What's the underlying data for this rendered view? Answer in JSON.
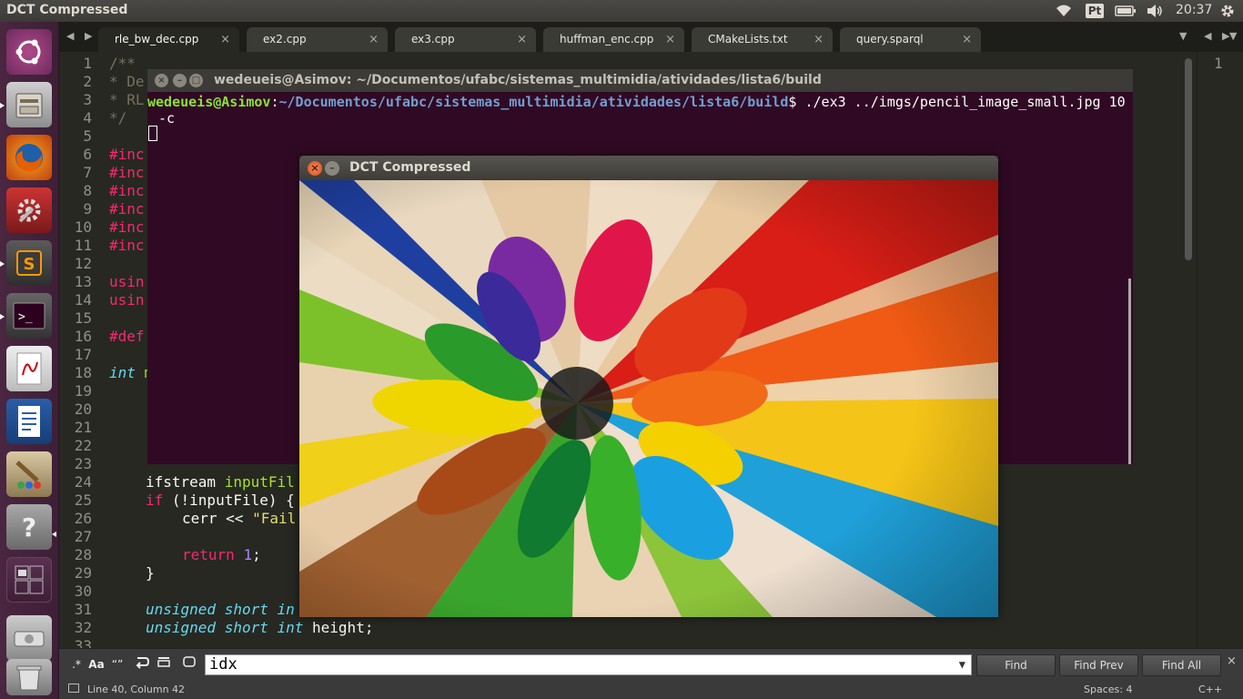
{
  "panel": {
    "title": "DCT Compressed",
    "keyboard": "Pt",
    "clock": "20:37"
  },
  "launcher": {
    "items": [
      "ubuntu-dash",
      "files",
      "firefox",
      "system-settings",
      "sublime-text",
      "terminal",
      "document-viewer",
      "libreoffice-writer",
      "gimp",
      "help",
      "workspace-switcher",
      "disk",
      "trash"
    ]
  },
  "tabs": [
    {
      "label": "rle_bw_dec.cpp",
      "active": true
    },
    {
      "label": "ex2.cpp",
      "active": false
    },
    {
      "label": "ex3.cpp",
      "active": false
    },
    {
      "label": "huffman_enc.cpp",
      "active": false
    },
    {
      "label": "CMakeLists.txt",
      "active": false
    },
    {
      "label": "query.sparql",
      "active": false
    }
  ],
  "editor": {
    "line_numbers": [
      "1",
      "2",
      "3",
      "4",
      "5",
      "6",
      "7",
      "8",
      "9",
      "10",
      "11",
      "12",
      "13",
      "14",
      "15",
      "16",
      "17",
      "18",
      "19",
      "20",
      "21",
      "22",
      "23",
      "24",
      "25",
      "26",
      "27",
      "28",
      "29",
      "30",
      "31",
      "32",
      "33"
    ],
    "right_line_number": "1",
    "lines": {
      "l1": "/**",
      "l2": "* De",
      "l3": "* RL",
      "l4": "*/",
      "l6": "#inc",
      "l7": "#inc",
      "l8": "#inc",
      "l9": "#inc",
      "l10": "#inc",
      "l11": "#inc",
      "l13": "usin",
      "l14": "usin",
      "l16": "#def",
      "l18_kw": "int",
      "l18_rest": "m",
      "l24_a": "ifstream ",
      "l24_b": "inputFil",
      "l25_kw": "if",
      "l25_rest": " (!inputFile) {",
      "l26_a": "cerr << ",
      "l26_b": "\"Fail",
      "l28_kw": "return",
      "l28_num": "1",
      "l28_end": ";",
      "l29": "}",
      "l31": "unsigned short in",
      "l32_ty": "unsigned short int",
      "l32_rest": " height;"
    }
  },
  "terminal": {
    "title": "wedeueis@Asimov: ~/Documentos/ufabc/sistemas_multimidia/atividades/lista6/build",
    "prompt_user": "wedeueis@Asimov",
    "prompt_sep": ":",
    "prompt_path": "~/Documentos/ufabc/sistemas_multimidia/atividades/lista6/build",
    "prompt_dollar": "$",
    "command": " ./ex3 ../imgs/pencil_image_small.jpg 10",
    "command_wrap": "-c"
  },
  "dct_window": {
    "title": "DCT Compressed",
    "image": "colored-pencils-photo"
  },
  "findbar": {
    "options": [
      "regex",
      "case",
      "whole-word",
      "wrap",
      "in-selection",
      "highlight"
    ],
    "regex_label": ".*",
    "case_label": "Aa",
    "word_label": "“”",
    "query": "idx",
    "find_label": "Find",
    "find_prev_label": "Find Prev",
    "find_all_label": "Find All"
  },
  "statusbar": {
    "position": "Line 40, Column 42",
    "indent": "Spaces: 4",
    "syntax": "C++"
  }
}
